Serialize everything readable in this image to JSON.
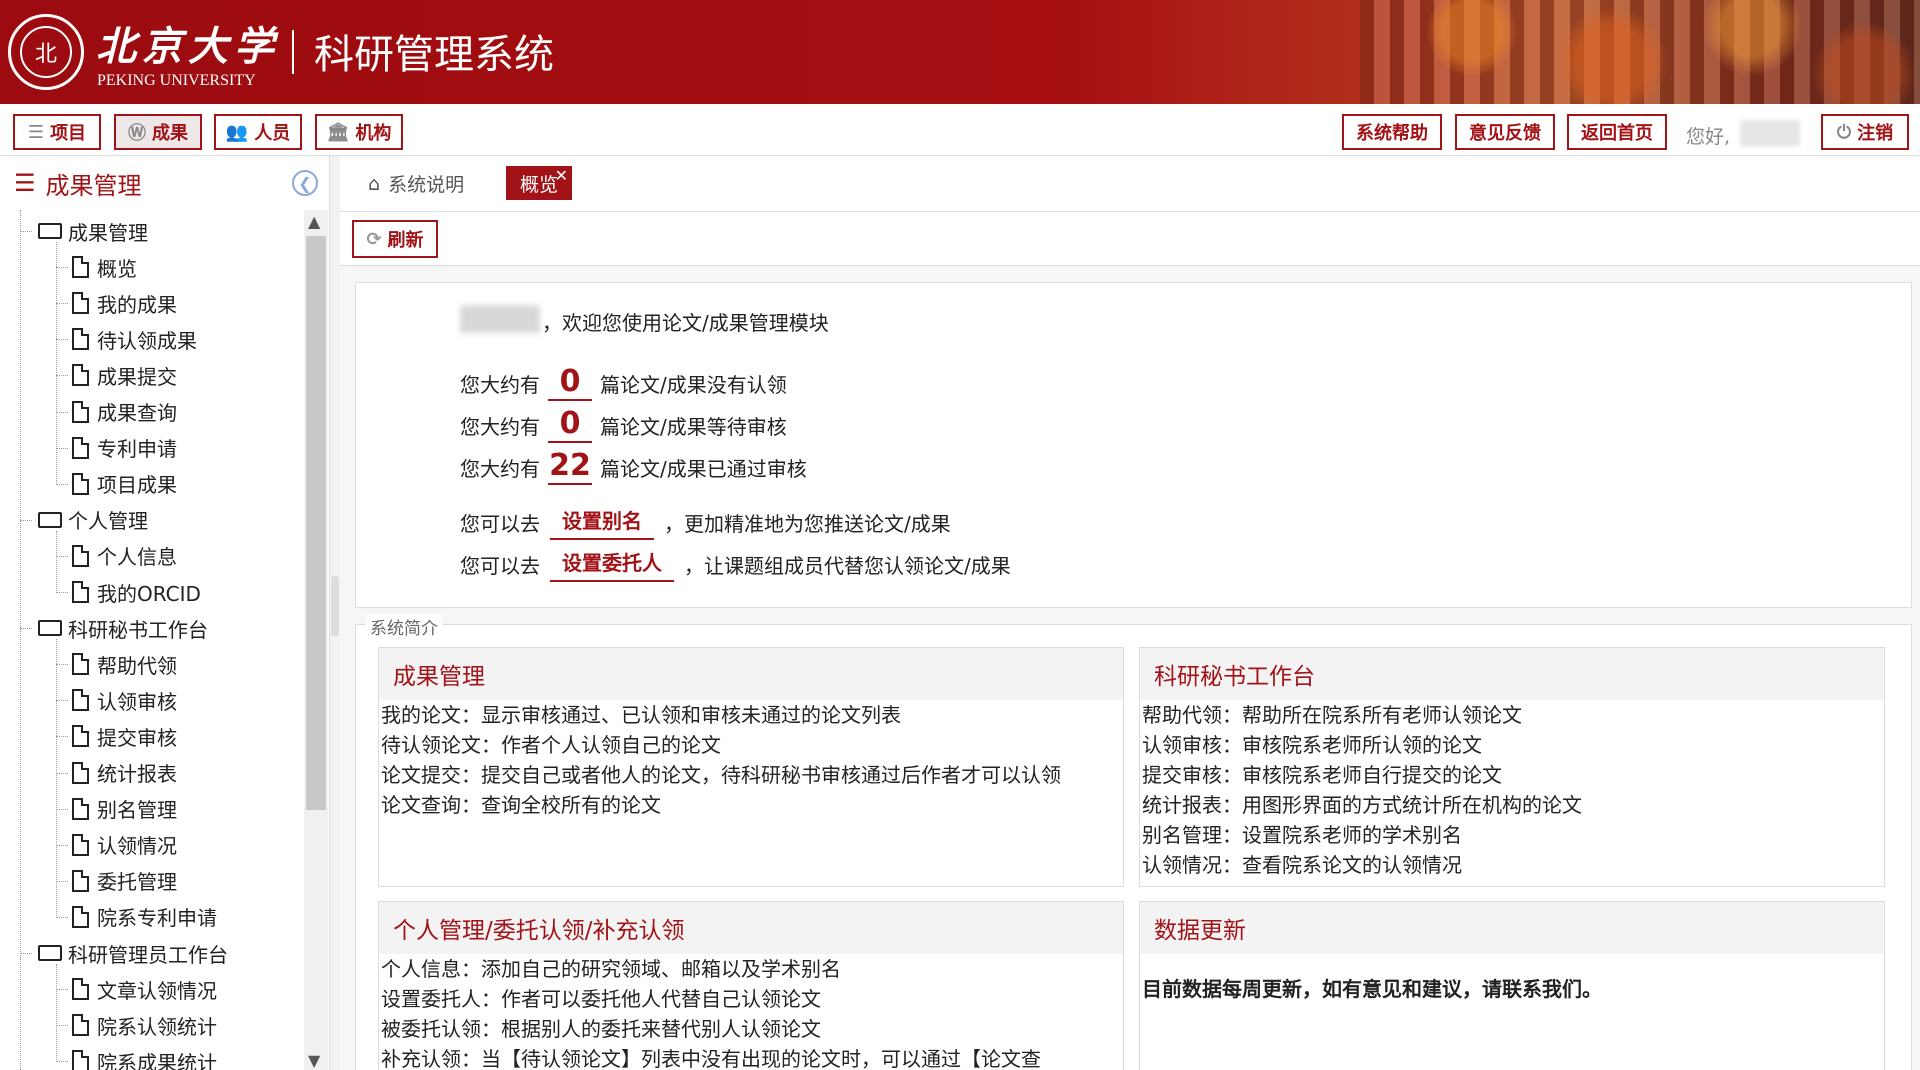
{
  "header": {
    "university_cn": "北京大学",
    "university_en": "PEKING UNIVERSITY",
    "system_title": "科研管理系统"
  },
  "toolbar": {
    "left": [
      {
        "label": "项目",
        "icon": "list-icon"
      },
      {
        "label": "成果",
        "icon": "wordpress-icon"
      },
      {
        "label": "人员",
        "icon": "users-icon"
      },
      {
        "label": "机构",
        "icon": "institution-icon"
      }
    ],
    "right": [
      {
        "label": "系统帮助"
      },
      {
        "label": "意见反馈"
      },
      {
        "label": "返回首页"
      }
    ],
    "greeting": "您好,",
    "logout": "注销"
  },
  "sidebar": {
    "title": "成果管理",
    "groups": [
      {
        "label": "成果管理",
        "items": [
          "概览",
          "我的成果",
          "待认领成果",
          "成果提交",
          "成果查询",
          "专利申请",
          "项目成果"
        ]
      },
      {
        "label": "个人管理",
        "items": [
          "个人信息",
          "我的ORCID"
        ]
      },
      {
        "label": "科研秘书工作台",
        "items": [
          "帮助代领",
          "认领审核",
          "提交审核",
          "统计报表",
          "别名管理",
          "认领情况",
          "委托管理",
          "院系专利申请"
        ]
      },
      {
        "label": "科研管理员工作台",
        "items": [
          "文章认领情况",
          "院系认领统计",
          "院系成果统计"
        ]
      }
    ]
  },
  "tabs": {
    "home": "系统说明",
    "active": "概览",
    "close": "✕"
  },
  "refresh": "刷新",
  "welcome": {
    "text": "，欢迎您使用论文/成果管理模块",
    "stats": [
      {
        "prefix": "您大约有",
        "value": "0",
        "suffix": "篇论文/成果没有认领"
      },
      {
        "prefix": "您大约有",
        "value": "0",
        "suffix": "篇论文/成果等待审核"
      },
      {
        "prefix": "您大约有",
        "value": "22",
        "suffix": "篇论文/成果已通过审核"
      }
    ],
    "links": [
      {
        "prefix": "您可以去",
        "link": "设置别名",
        "suffix": "，更加精准地为您推送论文/成果"
      },
      {
        "prefix": "您可以去",
        "link": "设置委托人",
        "suffix": "，让课题组成员代替您认领论文/成果"
      }
    ]
  },
  "intro": {
    "legend": "系统简介",
    "cards": [
      {
        "title": "成果管理",
        "lines": [
          "我的论文：显示审核通过、已认领和审核未通过的论文列表",
          "待认领论文：作者个人认领自己的论文",
          "论文提交：提交自己或者他人的论文，待科研秘书审核通过后作者才可以认领",
          "论文查询：查询全校所有的论文"
        ]
      },
      {
        "title": "科研秘书工作台",
        "lines": [
          "帮助代领：帮助所在院系所有老师认领论文",
          "认领审核：审核院系老师所认领的论文",
          "提交审核：审核院系老师自行提交的论文",
          "统计报表：用图形界面的方式统计所在机构的论文",
          "别名管理：设置院系老师的学术别名",
          "认领情况：查看院系论文的认领情况"
        ]
      },
      {
        "title": "个人管理/委托认领/补充认领",
        "lines": [
          "个人信息：添加自己的研究领域、邮箱以及学术别名",
          "设置委托人：作者可以委托他人代替自己认领论文",
          "被委托认领：根据别人的委托来替代别人认领论文",
          "补充认领：当【待认领论文】列表中没有出现的论文时，可以通过【论文查"
        ]
      },
      {
        "title": "数据更新",
        "lines": [
          "目前数据每周更新，如有意见和建议，请联系我们。"
        ]
      }
    ]
  },
  "colors": {
    "brand": "#a21317"
  }
}
